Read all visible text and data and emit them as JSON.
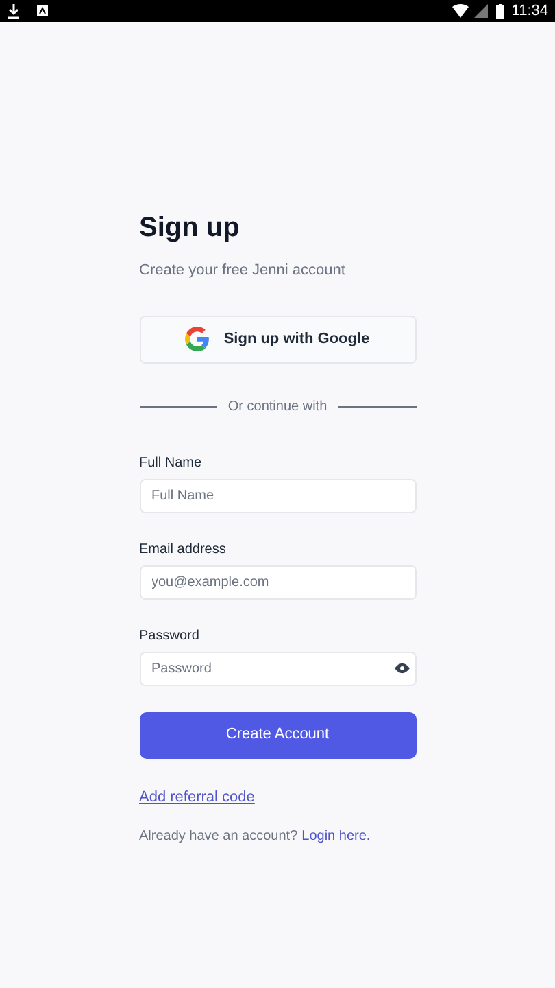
{
  "status_bar": {
    "time": "11:34"
  },
  "title": "Sign up",
  "subtitle": "Create your free Jenni account",
  "google_button": {
    "label": "Sign up with Google"
  },
  "divider": {
    "label": "Or continue with"
  },
  "fields": [
    {
      "label": "Full Name",
      "placeholder": "Full Name",
      "kind": "text"
    },
    {
      "label": "Email address",
      "placeholder": "you@example.com",
      "kind": "email"
    },
    {
      "label": "Password",
      "placeholder": "Password",
      "kind": "password"
    }
  ],
  "submit_button": {
    "label": "Create Account"
  },
  "referral_link": "Add referral code",
  "footer": {
    "text": "Already have an account?",
    "link": "Login here."
  }
}
